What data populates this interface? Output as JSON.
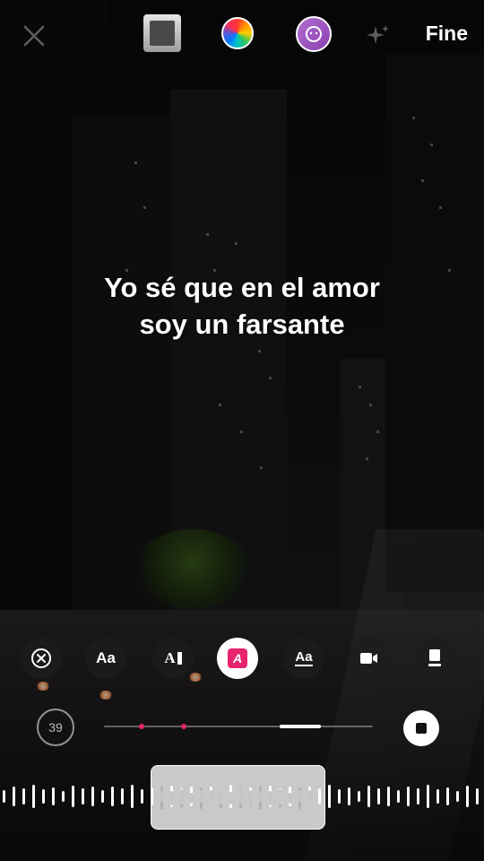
{
  "top_bar": {
    "done_label": "Fine",
    "icons": [
      "close-icon",
      "album-sticker-icon",
      "color-wheel-icon",
      "avatar-sticker-icon",
      "sparkle-icon"
    ]
  },
  "lyrics": {
    "line1": "Yo sé que en el amor",
    "line2": "soy un farsante"
  },
  "toolbar": {
    "aa_label": "Aa",
    "ai_label": "A",
    "a_label": "A",
    "aa_under_label": "Aa",
    "active_color": "#e8246e"
  },
  "player": {
    "timer": "39"
  },
  "colors": {
    "accent": "#e8246e",
    "text": "#ffffff"
  }
}
